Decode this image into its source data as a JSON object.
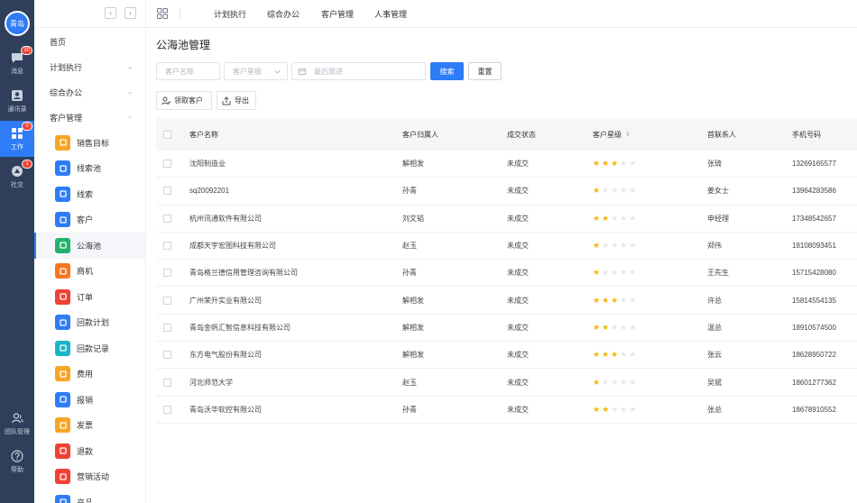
{
  "rail": {
    "brand": "青岛",
    "items": [
      {
        "label": "消息",
        "icon": "chat-icon",
        "badge": "30"
      },
      {
        "label": "通讯录",
        "icon": "contacts-icon",
        "badge": ""
      },
      {
        "label": "工作",
        "icon": "apps-icon",
        "badge": "0"
      },
      {
        "label": "社交",
        "icon": "social-icon",
        "badge": "1"
      }
    ],
    "bottom": [
      {
        "label": "团队管理",
        "icon": "team-icon"
      },
      {
        "label": "帮助",
        "icon": "help-icon"
      }
    ]
  },
  "nav": {
    "back": "‹",
    "forward": "›"
  },
  "topbar": {
    "tabs": [
      "计划执行",
      "综合办公",
      "客户管理",
      "人事管理"
    ]
  },
  "sidebar": {
    "home": "首页",
    "groups": [
      {
        "label": "计划执行",
        "chevron": "⌄"
      },
      {
        "label": "综合办公",
        "chevron": "⌄"
      },
      {
        "label": "客户管理",
        "chevron": "⌃"
      }
    ],
    "items": [
      {
        "label": "销售目标",
        "color": "#f5a623",
        "icon": "target-icon"
      },
      {
        "label": "线索池",
        "color": "#2e7cf6",
        "icon": "leads-pool-icon"
      },
      {
        "label": "线索",
        "color": "#2e7cf6",
        "icon": "leads-icon"
      },
      {
        "label": "客户",
        "color": "#2e7cf6",
        "icon": "customer-icon"
      },
      {
        "label": "公海池",
        "color": "#23b26d",
        "icon": "public-pool-icon"
      },
      {
        "label": "商机",
        "color": "#f5771f",
        "icon": "opportunity-icon"
      },
      {
        "label": "订单",
        "color": "#f04134",
        "icon": "order-icon"
      },
      {
        "label": "回款计划",
        "color": "#2e7cf6",
        "icon": "payment-plan-icon"
      },
      {
        "label": "回款记录",
        "color": "#19b5c8",
        "icon": "payment-record-icon"
      },
      {
        "label": "费用",
        "color": "#f5a623",
        "icon": "expense-icon"
      },
      {
        "label": "报销",
        "color": "#2e7cf6",
        "icon": "reimburse-icon"
      },
      {
        "label": "发票",
        "color": "#f5a623",
        "icon": "invoice-icon"
      },
      {
        "label": "退款",
        "color": "#f04134",
        "icon": "refund-icon"
      },
      {
        "label": "营销活动",
        "color": "#f04134",
        "icon": "campaign-icon"
      },
      {
        "label": "产品",
        "color": "#2e7cf6",
        "icon": "product-icon"
      }
    ],
    "active_index": 4
  },
  "page": {
    "title": "公海池管理",
    "filters": {
      "customer_name_placeholder": "客户名称",
      "customer_level_placeholder": "客户星级",
      "last_follow_placeholder": "最后跟进",
      "search_label": "搜索",
      "reset_label": "重置"
    },
    "actions": {
      "claim_label": "领取客户",
      "export_label": "导出"
    },
    "table": {
      "columns": [
        "客户名称",
        "客户归属人",
        "成交状态",
        "客户星级",
        "首联系人",
        "手机号码"
      ],
      "sort_icon": "⇕",
      "rows": [
        {
          "name": "沈阳制造业",
          "owner": "解相发",
          "status": "未成交",
          "stars": 3,
          "contact": "张琦",
          "phone": "13269165577"
        },
        {
          "name": "sq20092201",
          "owner": "孙青",
          "status": "未成交",
          "stars": 1,
          "contact": "姜女士",
          "phone": "13964283586"
        },
        {
          "name": "杭州讯通软件有限公司",
          "owner": "刘文韬",
          "status": "未成交",
          "stars": 2,
          "contact": "申经理",
          "phone": "17348542657"
        },
        {
          "name": "成都天宇宏图科技有限公司",
          "owner": "赵玉",
          "status": "未成交",
          "stars": 1,
          "contact": "郑伟",
          "phone": "18108093451"
        },
        {
          "name": "青岛格兰德信用管理咨询有限公司",
          "owner": "孙青",
          "status": "未成交",
          "stars": 1,
          "contact": "王先生",
          "phone": "15715428080"
        },
        {
          "name": "广州荣升实业有限公司",
          "owner": "解相发",
          "status": "未成交",
          "stars": 3,
          "contact": "许总",
          "phone": "15814554135"
        },
        {
          "name": "青岛金帆汇智信息科技有限公司",
          "owner": "解相发",
          "status": "未成交",
          "stars": 2,
          "contact": "温总",
          "phone": "18910574500"
        },
        {
          "name": "东方电气股份有限公司",
          "owner": "解相发",
          "status": "未成交",
          "stars": 3,
          "contact": "张云",
          "phone": "18628950722"
        },
        {
          "name": "河北师范大学",
          "owner": "赵玉",
          "status": "未成交",
          "stars": 1,
          "contact": "吴斌",
          "phone": "18601277362"
        },
        {
          "name": "青岛沃华软控有限公司",
          "owner": "孙青",
          "status": "未成交",
          "stars": 2,
          "contact": "张总",
          "phone": "18678910552"
        }
      ]
    }
  }
}
